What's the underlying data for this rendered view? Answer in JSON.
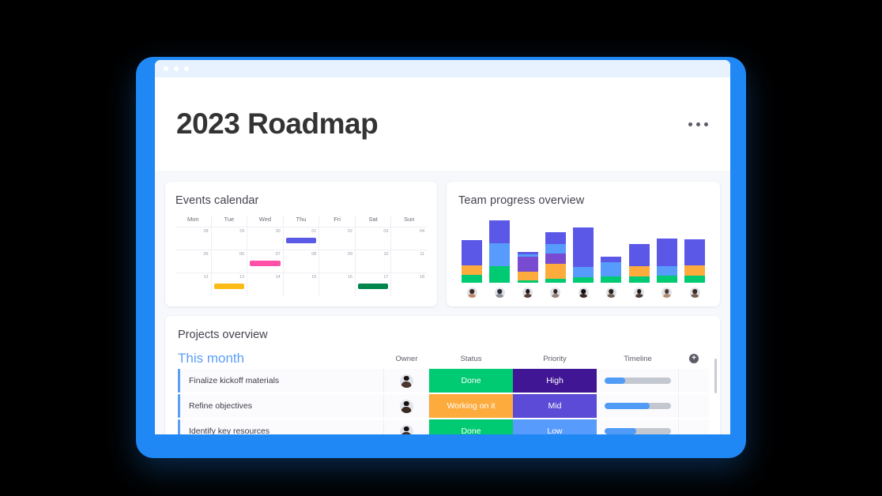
{
  "window": {
    "dots": [
      "dot-1",
      "dot-2",
      "dot-3"
    ]
  },
  "header": {
    "title": "2023 Roadmap",
    "more_menu_icon": "ellipsis-icon"
  },
  "events_calendar": {
    "title": "Events calendar",
    "day_headers": [
      "Mon",
      "Tue",
      "Wed",
      "Thu",
      "Fri",
      "Sat",
      "Sun"
    ],
    "weeks": [
      {
        "days": [
          {
            "num": "28",
            "event": null
          },
          {
            "num": "29",
            "event": null
          },
          {
            "num": "30",
            "event": null
          },
          {
            "num": "01",
            "event": {
              "color": "#5a5ae6",
              "span": 1
            }
          },
          {
            "num": "02",
            "event": null
          },
          {
            "num": "03",
            "event": null
          },
          {
            "num": "04",
            "event": null
          }
        ]
      },
      {
        "days": [
          {
            "num": "05",
            "event": null
          },
          {
            "num": "06",
            "event": null
          },
          {
            "num": "07",
            "event": {
              "color": "#ff51a8",
              "span": 1
            }
          },
          {
            "num": "08",
            "event": null
          },
          {
            "num": "09",
            "event": null
          },
          {
            "num": "10",
            "event": null
          },
          {
            "num": "11",
            "event": null
          }
        ]
      },
      {
        "days": [
          {
            "num": "12",
            "event": null
          },
          {
            "num": "13",
            "event": {
              "color": "#fdbb17",
              "span": 1
            }
          },
          {
            "num": "14",
            "event": null
          },
          {
            "num": "15",
            "event": null
          },
          {
            "num": "16",
            "event": null
          },
          {
            "num": "17",
            "event": {
              "color": "#00854d",
              "span": 1
            }
          },
          {
            "num": "18",
            "event": null
          }
        ]
      }
    ]
  },
  "team_progress": {
    "title": "Team progress overview",
    "chart_data": {
      "type": "bar",
      "stacked": true,
      "title": "Team progress overview",
      "xlabel": "",
      "ylabel": "",
      "grid": false,
      "legend": false,
      "ylim": [
        0,
        88
      ],
      "categories": [
        "member-1",
        "member-2",
        "member-3",
        "member-4",
        "member-5",
        "member-6",
        "member-7",
        "member-8",
        "member-9"
      ],
      "segment_colors": {
        "green": "#00ca72",
        "orange": "#fdab3d",
        "purple": "#784bd1",
        "light_blue": "#579bfc",
        "indigo": "#5b58e8"
      },
      "series": [
        {
          "name": "green",
          "color": "#00ca72",
          "values": [
            10,
            21,
            3,
            5,
            7,
            8,
            8,
            9,
            9
          ]
        },
        {
          "name": "orange",
          "color": "#fdab3d",
          "values": [
            12,
            0,
            11,
            19,
            0,
            0,
            13,
            0,
            13
          ]
        },
        {
          "name": "purple",
          "color": "#784bd1",
          "values": [
            0,
            0,
            19,
            13,
            0,
            0,
            0,
            0,
            0
          ]
        },
        {
          "name": "light_blue",
          "color": "#579bfc",
          "values": [
            0,
            29,
            3,
            12,
            13,
            18,
            0,
            12,
            0
          ]
        },
        {
          "name": "indigo",
          "color": "#5b58e8",
          "values": [
            32,
            29,
            3,
            15,
            50,
            7,
            28,
            35,
            33
          ]
        }
      ],
      "totals": [
        54,
        79,
        39,
        64,
        70,
        33,
        49,
        56,
        55
      ]
    },
    "avatars": [
      {
        "name": "avatar-1",
        "hair": "#3a2a22",
        "body": "#c08a6a"
      },
      {
        "name": "avatar-2",
        "hair": "#2b2b33",
        "body": "#8d9099"
      },
      {
        "name": "avatar-3",
        "hair": "#1d1510",
        "body": "#5a3f33"
      },
      {
        "name": "avatar-4",
        "hair": "#33261d",
        "body": "#97837a"
      },
      {
        "name": "avatar-5",
        "hair": "#140f0c",
        "body": "#3d2b24"
      },
      {
        "name": "avatar-6",
        "hair": "#2c2118",
        "body": "#6d6158"
      },
      {
        "name": "avatar-7",
        "hair": "#221814",
        "body": "#4e3b33"
      },
      {
        "name": "avatar-8",
        "hair": "#4a3527",
        "body": "#b58e72"
      },
      {
        "name": "avatar-9",
        "hair": "#3b2c22",
        "body": "#7d6252"
      }
    ]
  },
  "projects_overview": {
    "title": "Projects overview",
    "group_label": "This month",
    "add_column_label": "+",
    "columns": [
      "Owner",
      "Status",
      "Priority",
      "Timeline"
    ],
    "rows": [
      {
        "name": "Finalize kickoff materials",
        "owner": {
          "name": "owner-avatar-1",
          "hair": "#191210",
          "body": "#4a352c"
        },
        "status": {
          "label": "Done",
          "color": "#00ca72"
        },
        "priority": {
          "label": "High",
          "color": "#401694"
        },
        "timeline": {
          "percent": 31
        }
      },
      {
        "name": "Refine objectives",
        "owner": {
          "name": "owner-avatar-2",
          "hair": "#15100d",
          "body": "#3a2a21"
        },
        "status": {
          "label": "Working on it",
          "color": "#fdab3d"
        },
        "priority": {
          "label": "Mid",
          "color": "#5b4bd6"
        },
        "timeline": {
          "percent": 68
        }
      },
      {
        "name": "Identify key resources",
        "owner": {
          "name": "owner-avatar-3",
          "hair": "#17110e",
          "body": "#402e25"
        },
        "status": {
          "label": "Done",
          "color": "#00ca72"
        },
        "priority": {
          "label": "Low",
          "color": "#579bfc"
        },
        "timeline": {
          "percent": 48
        }
      }
    ]
  },
  "colors": {
    "frame_blue": "#1f88f5",
    "accent_blue": "#5b9ef7",
    "page_background": "#f7f8fb"
  }
}
